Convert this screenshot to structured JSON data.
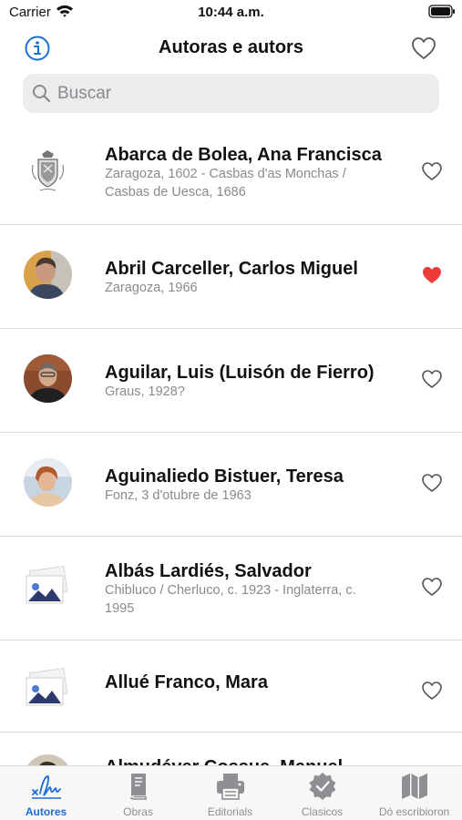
{
  "status_bar": {
    "carrier": "Carrier",
    "time": "10:44 a.m."
  },
  "nav": {
    "title": "Autoras e autors"
  },
  "search": {
    "placeholder": "Buscar"
  },
  "authors": [
    {
      "name": "Abarca de Bolea, Ana Francisca",
      "info": "Zaragoza, 1602 - Casbas d'as Monchas / Casbas de Uesca, 1686",
      "favorite": false,
      "photo": "coat-of-arms"
    },
    {
      "name": "Abril Carceller, Carlos Miguel",
      "info": "Zaragoza, 1966",
      "favorite": true,
      "photo": "portrait"
    },
    {
      "name": "Aguilar, Luis (Luisón de Fierro)",
      "info": "Graus, 1928?",
      "favorite": false,
      "photo": "portrait"
    },
    {
      "name": "Aguinaliedo Bistuer, Teresa",
      "info": "Fonz, 3 d'otubre de 1963",
      "favorite": false,
      "photo": "portrait"
    },
    {
      "name": "Albás Lardiés, Salvador",
      "info": "Chibluco / Cherluco, c. 1923  - Inglaterra, c. 1995",
      "favorite": false,
      "photo": "image-placeholder"
    },
    {
      "name": "Allué Franco, Mara",
      "info": "",
      "favorite": false,
      "photo": "image-placeholder"
    },
    {
      "name": "Almudéver Cossue, Manuel",
      "info": "",
      "favorite": false,
      "photo": "portrait"
    }
  ],
  "tabs": [
    {
      "label": "Autores",
      "icon": "signature-icon",
      "active": true
    },
    {
      "label": "Obras",
      "icon": "book-icon",
      "active": false
    },
    {
      "label": "Editorials",
      "icon": "printer-icon",
      "active": false
    },
    {
      "label": "Clasicos",
      "icon": "badge-check-icon",
      "active": false
    },
    {
      "label": "Dó escribioron",
      "icon": "map-icon",
      "active": false
    }
  ],
  "colors": {
    "accent": "#1b6fd6",
    "favorite": "#ef3a3a",
    "secondary_text": "#8a8a8e",
    "divider": "#dcdcdc"
  }
}
